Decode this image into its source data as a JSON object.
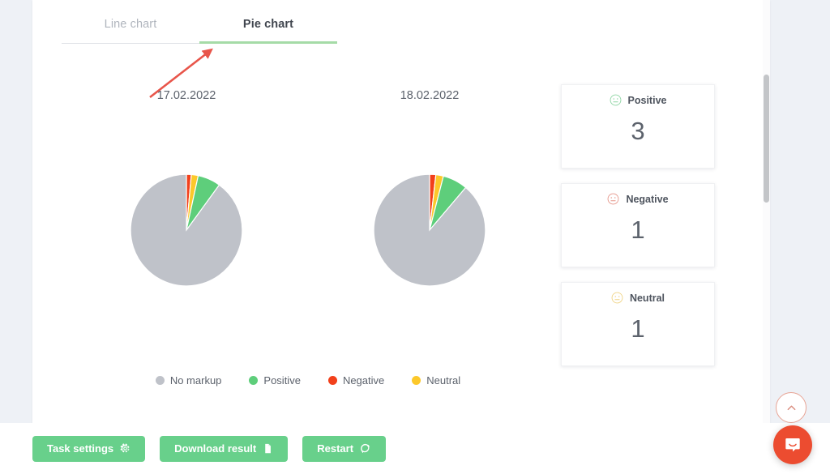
{
  "tabs": [
    {
      "label": "Line chart",
      "active": false,
      "name": "tab-line-chart"
    },
    {
      "label": "Pie chart",
      "active": true,
      "name": "tab-pie-chart"
    }
  ],
  "dates": [
    "17.02.2022",
    "18.02.2022"
  ],
  "legend": [
    {
      "label": "No markup",
      "color": "#bfc2c9"
    },
    {
      "label": "Positive",
      "color": "#5ece7b"
    },
    {
      "label": "Negative",
      "color": "#f2401b"
    },
    {
      "label": "Neutral",
      "color": "#fcc82a"
    }
  ],
  "cards": [
    {
      "title": "Positive",
      "value": "3",
      "icon": "smiley-face-icon",
      "color": "#8fd5a4"
    },
    {
      "title": "Negative",
      "value": "1",
      "icon": "smiley-face-icon",
      "color": "#e5968a"
    },
    {
      "title": "Neutral",
      "value": "1",
      "icon": "smiley-face-icon",
      "color": "#f0d486"
    }
  ],
  "buttons": [
    {
      "label": "Task settings",
      "icon": "gear-icon"
    },
    {
      "label": "Download result",
      "icon": "document-icon"
    },
    {
      "label": "Restart",
      "icon": "refresh-icon"
    }
  ],
  "scroll_top": {
    "icon": "chevron-up-icon"
  },
  "chat_widget": {
    "icon": "chat-bubble-icon"
  },
  "colors": {
    "accent_green": "#68d08b",
    "tab_underline": "#a5dba7",
    "chat_red": "#ec4c30",
    "annotation_red": "#e8554a",
    "page_bg": "#eef1f6"
  },
  "chart_data": [
    {
      "type": "pie",
      "title": "17.02.2022",
      "labels": [
        "Negative",
        "Neutral",
        "Positive",
        "No markup"
      ],
      "values": [
        1.4,
        2.0,
        6.6,
        90.0
      ],
      "colors": [
        "#f2401b",
        "#fcc82a",
        "#5ece7b",
        "#bfc2c9"
      ],
      "start_angle": 0,
      "legend_position": "bottom",
      "grid": false
    },
    {
      "type": "pie",
      "title": "18.02.2022",
      "labels": [
        "Negative",
        "Neutral",
        "Positive",
        "No markup"
      ],
      "values": [
        1.8,
        2.2,
        7.2,
        88.8
      ],
      "colors": [
        "#f2401b",
        "#fcc82a",
        "#5ece7b",
        "#bfc2c9"
      ],
      "start_angle": 0,
      "legend_position": "bottom",
      "grid": false
    }
  ]
}
